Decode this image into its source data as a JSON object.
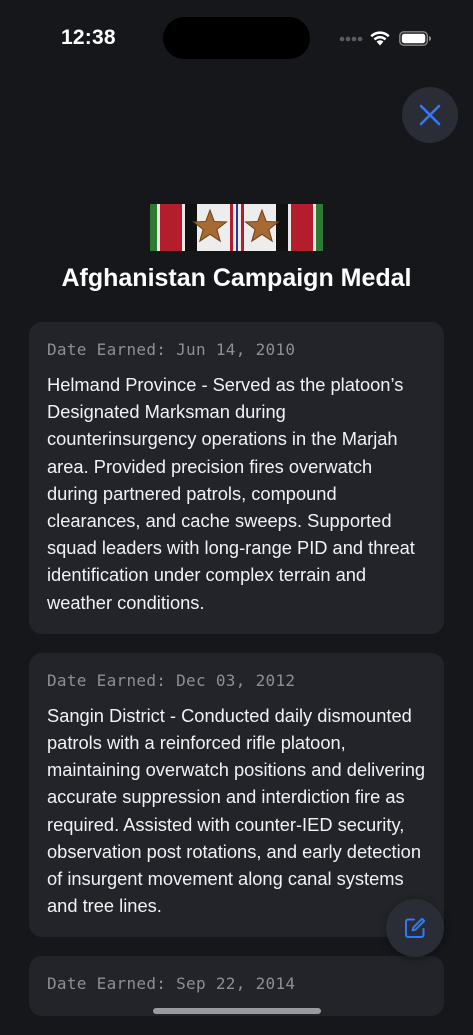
{
  "status_bar": {
    "time": "12:38"
  },
  "icons": {
    "close": "close-icon",
    "edit": "edit-icon",
    "wifi": "wifi-icon",
    "battery": "battery-icon",
    "signal": "signal-icon"
  },
  "colors": {
    "background": "#16171b",
    "card": "#22242a",
    "accent": "#3478f6",
    "muted_text": "#8d8f96"
  },
  "medal": {
    "title": "Afghanistan Campaign Medal"
  },
  "entries": [
    {
      "date": "Date Earned: Jun 14, 2010",
      "description": "Helmand Province - Served as the platoon’s Designated Marksman during counterinsurgency operations in the Marjah area. Provided precision fires overwatch during partnered patrols, compound clearances, and cache sweeps. Supported squad leaders with long-range PID and threat identification under complex terrain and weather conditions."
    },
    {
      "date": "Date Earned: Dec 03, 2012",
      "description": "Sangin District - Conducted daily dismounted patrols with a reinforced rifle platoon, maintaining overwatch positions and delivering accurate suppression and interdiction fire as required. Assisted with counter-IED security, observation post rotations, and early detection of insurgent movement along canal systems and tree lines."
    },
    {
      "date": "Date Earned: Sep 22, 2014",
      "description": ""
    }
  ]
}
